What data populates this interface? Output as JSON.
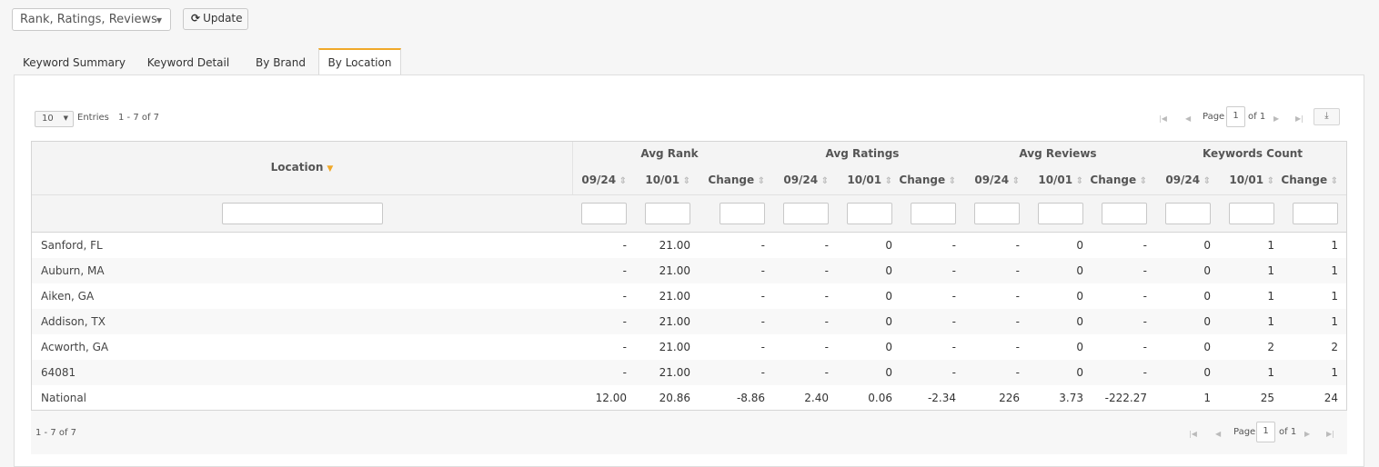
{
  "toolbar": {
    "view_select": "Rank, Ratings, Reviews",
    "update_label": "Update"
  },
  "tabs": [
    {
      "label": "Keyword Summary"
    },
    {
      "label": "Keyword Detail"
    },
    {
      "label": "By Brand"
    },
    {
      "label": "By Location"
    }
  ],
  "pager": {
    "entries_value": "10",
    "entries_label": "Entries",
    "range_text": "1 - 7 of 7",
    "page_label": "Page",
    "page_value": "1",
    "of_text": "of 1"
  },
  "table": {
    "location_header": "Location",
    "groups": [
      "Avg Rank",
      "Avg Ratings",
      "Avg Reviews",
      "Keywords Count"
    ],
    "subheaders": [
      "09/24",
      "10/01",
      "Change",
      "09/24",
      "10/01",
      "Change",
      "09/24",
      "10/01",
      "Change",
      "09/24",
      "10/01",
      "Change"
    ],
    "rows": [
      {
        "loc": "Sanford, FL",
        "v": [
          "-",
          "21.00",
          "-",
          "-",
          "0",
          "-",
          "-",
          "0",
          "-",
          "0",
          "1",
          "1"
        ]
      },
      {
        "loc": "Auburn, MA",
        "v": [
          "-",
          "21.00",
          "-",
          "-",
          "0",
          "-",
          "-",
          "0",
          "-",
          "0",
          "1",
          "1"
        ]
      },
      {
        "loc": "Aiken, GA",
        "v": [
          "-",
          "21.00",
          "-",
          "-",
          "0",
          "-",
          "-",
          "0",
          "-",
          "0",
          "1",
          "1"
        ]
      },
      {
        "loc": "Addison, TX",
        "v": [
          "-",
          "21.00",
          "-",
          "-",
          "0",
          "-",
          "-",
          "0",
          "-",
          "0",
          "1",
          "1"
        ]
      },
      {
        "loc": "Acworth, GA",
        "v": [
          "-",
          "21.00",
          "-",
          "-",
          "0",
          "-",
          "-",
          "0",
          "-",
          "0",
          "2",
          "2"
        ]
      },
      {
        "loc": "64081",
        "v": [
          "-",
          "21.00",
          "-",
          "-",
          "0",
          "-",
          "-",
          "0",
          "-",
          "0",
          "1",
          "1"
        ]
      },
      {
        "loc": "National",
        "v": [
          "12.00",
          "20.86",
          "-8.86",
          "2.40",
          "0.06",
          "-2.34",
          "226",
          "3.73",
          "-222.27",
          "1",
          "25",
          "24"
        ]
      }
    ]
  }
}
